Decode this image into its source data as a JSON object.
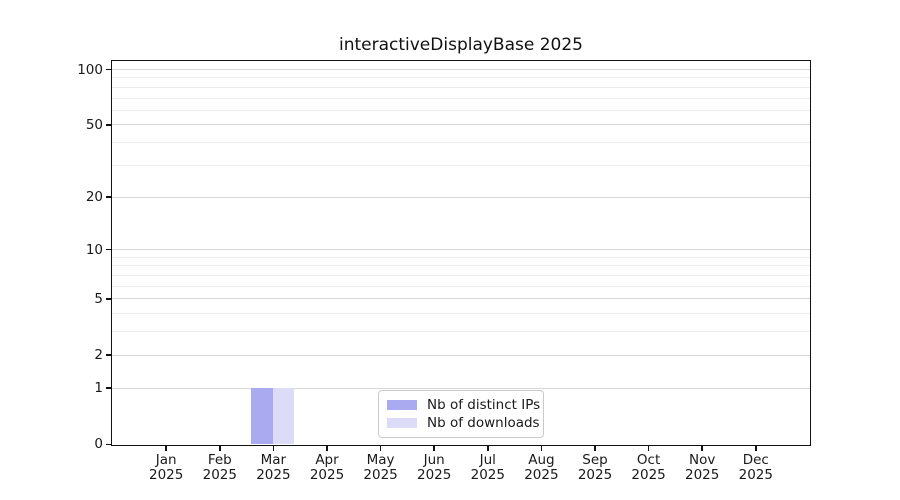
{
  "title": "interactiveDisplayBase 2025",
  "chart_data": {
    "type": "bar",
    "title": "interactiveDisplayBase 2025",
    "categories": [
      "Jan",
      "Feb",
      "Mar",
      "Apr",
      "May",
      "Jun",
      "Jul",
      "Aug",
      "Sep",
      "Oct",
      "Nov",
      "Dec"
    ],
    "year_label": "2025",
    "series": [
      {
        "name": "Nb of distinct IPs",
        "color": "#aaaaf0",
        "values": [
          0,
          0,
          1,
          0,
          0,
          0,
          0,
          0,
          0,
          0,
          0,
          0
        ]
      },
      {
        "name": "Nb of downloads",
        "color": "#dcdcf8",
        "values": [
          0,
          0,
          1,
          0,
          0,
          0,
          0,
          0,
          0,
          0,
          0,
          0
        ]
      }
    ],
    "xlabel": "",
    "ylabel": "",
    "y_axis_scale": "log10(1+v)",
    "y_major_ticks": [
      0,
      1,
      2,
      5,
      10,
      20,
      50,
      100
    ],
    "y_minor_gridlines": [
      3,
      4,
      6,
      7,
      8,
      9,
      30,
      40,
      60,
      70,
      80,
      90
    ],
    "ylim": [
      0,
      112
    ],
    "grid": true,
    "legend_position": "bottom-center"
  },
  "colors": {
    "bar_distinct_ips": "#aaaaf0",
    "bar_downloads": "#dcdcf8",
    "major_grid": "#d6d6d6",
    "minor_grid": "#ececec",
    "spine": "#111111",
    "text": "#1a1a1a",
    "legend_border": "#c9c9c9"
  }
}
